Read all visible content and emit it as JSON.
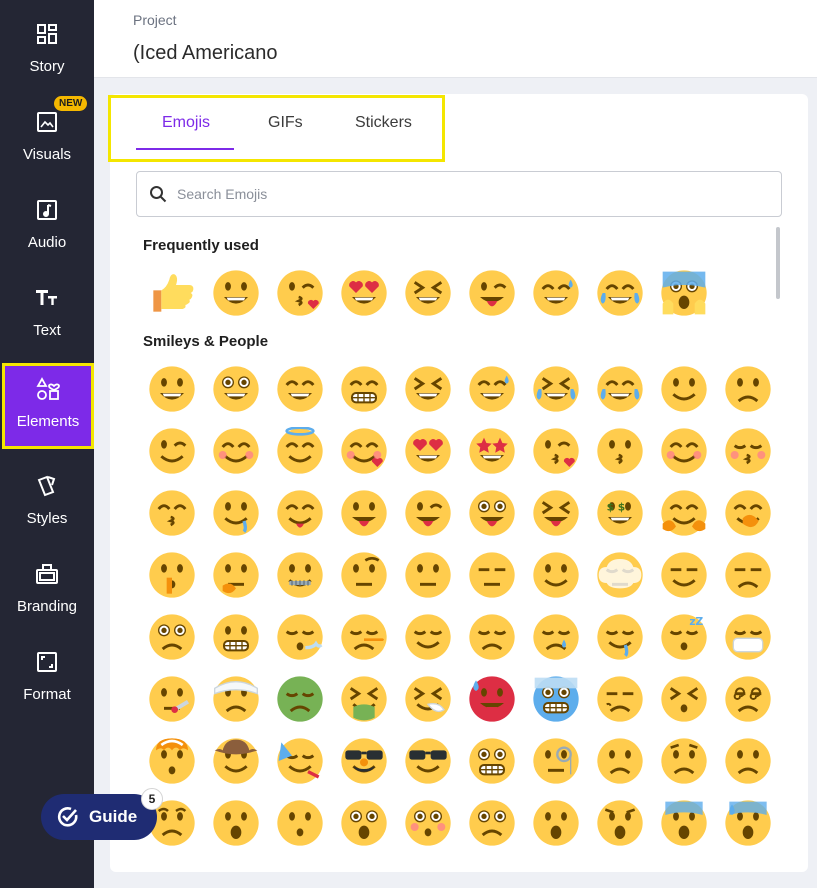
{
  "sidebar": {
    "items": [
      {
        "label": "Story",
        "icon": "story-icon"
      },
      {
        "label": "Visuals",
        "icon": "image-icon",
        "badge": "NEW"
      },
      {
        "label": "Audio",
        "icon": "music-note-icon"
      },
      {
        "label": "Text",
        "icon": "text-icon"
      },
      {
        "label": "Elements",
        "icon": "shapes-icon"
      },
      {
        "label": "Styles",
        "icon": "styles-icon"
      },
      {
        "label": "Branding",
        "icon": "briefcase-icon"
      },
      {
        "label": "Format",
        "icon": "resize-icon"
      }
    ],
    "active": "Elements"
  },
  "header": {
    "breadcrumb": "Project",
    "title": "(Iced Americano"
  },
  "panel": {
    "tabs": [
      {
        "label": "Emojis"
      },
      {
        "label": "GIFs"
      },
      {
        "label": "Stickers"
      }
    ],
    "active_tab": "Emojis",
    "search": {
      "placeholder": "Search Emojis",
      "value": ""
    },
    "sections": [
      {
        "title": "Frequently used",
        "emojis": [
          "thumbs-up",
          "grinning",
          "kissing-heart",
          "heart-eyes",
          "laughing",
          "tongue-wink",
          "sweat-smile",
          "joy",
          "scream"
        ]
      },
      {
        "title": "Smileys & People",
        "emojis": [
          "grinning",
          "smiley",
          "smile",
          "grin",
          "laughing",
          "sweat-smile",
          "rofl",
          "joy",
          "slight-smile",
          "upside-down",
          "wink",
          "blush",
          "innocent",
          "smiling-hearts",
          "heart-eyes",
          "star-struck",
          "kissing-heart",
          "kissing",
          "relaxed",
          "kissing-closed-eyes",
          "kissing-smiling-eyes",
          "drooling",
          "yum",
          "tongue",
          "tongue-wink",
          "zany",
          "tongue-closed-eyes",
          "money-mouth",
          "hugging",
          "hand-over-mouth",
          "shushing",
          "thinking",
          "zipper-mouth",
          "raised-eyebrow",
          "neutral",
          "expressionless",
          "no-mouth",
          "face-in-clouds",
          "smirk",
          "unamused",
          "rolling-eyes",
          "grimacing",
          "exhaling",
          "lying",
          "relieved",
          "pensive",
          "sleepy",
          "drooling-2",
          "sleeping",
          "mask",
          "thermometer",
          "bandage",
          "nauseated",
          "vomiting",
          "sneezing",
          "hot",
          "cold",
          "woozy",
          "dizzy",
          "spiral-eyes",
          "exploding-head",
          "cowboy",
          "partying",
          "disguised",
          "sunglasses",
          "nerd",
          "monocle",
          "confused",
          "worried",
          "slight-frown",
          "frowning",
          "open-mouth",
          "hushed",
          "astonished",
          "flushed",
          "pleading",
          "frowning-open",
          "anguished",
          "fearful",
          "cold-sweat"
        ]
      }
    ]
  },
  "guide": {
    "label": "Guide",
    "count": "5"
  },
  "colors": {
    "accent": "#7d2ae8",
    "sidebar": "#242634",
    "highlight": "#f4e600",
    "guide": "#1f2c73",
    "emoji": "#ffcc4d"
  }
}
